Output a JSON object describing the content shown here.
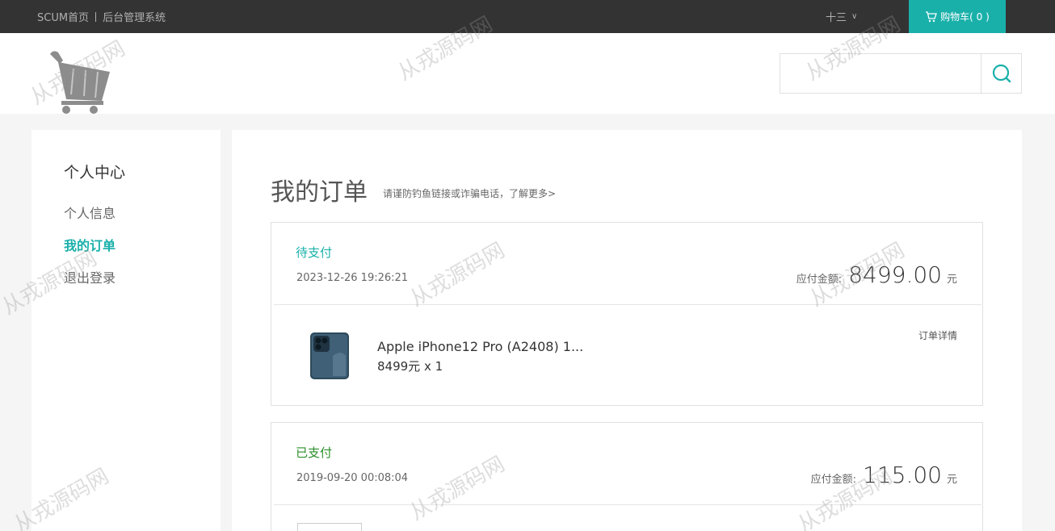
{
  "topbar": {
    "home_link": "SCUM首页",
    "admin_link": "后台管理系统",
    "username": "十三",
    "cart_label": "购物车( 0 )"
  },
  "header": {
    "search_placeholder": ""
  },
  "sidebar": {
    "title": "个人中心",
    "items": [
      {
        "label": "个人信息"
      },
      {
        "label": "我的订单"
      },
      {
        "label": "退出登录"
      }
    ]
  },
  "main": {
    "title": "我的订单",
    "notice": "请谨防钓鱼链接或诈骗电话，了解更多>",
    "orders": [
      {
        "status": "待支付",
        "status_color": "#1ab0aa",
        "date": "2023-12-26 19:26:21",
        "total_label": "应付金额:",
        "total_amount": "8499.00",
        "unit": "元",
        "detail_link": "订单详情",
        "product_name": "Apple iPhone12 Pro (A2408) 1...",
        "product_price": "8499元 x 1"
      },
      {
        "status": "已支付",
        "status_color": "#2a8f2a",
        "date": "2019-09-20 00:08:04",
        "total_label": "应付金额:",
        "total_amount": "115.00",
        "unit": "元"
      }
    ]
  },
  "watermark": "从戎源码网",
  "colors": {
    "accent": "#1ab0aa",
    "topbar": "#333333"
  }
}
